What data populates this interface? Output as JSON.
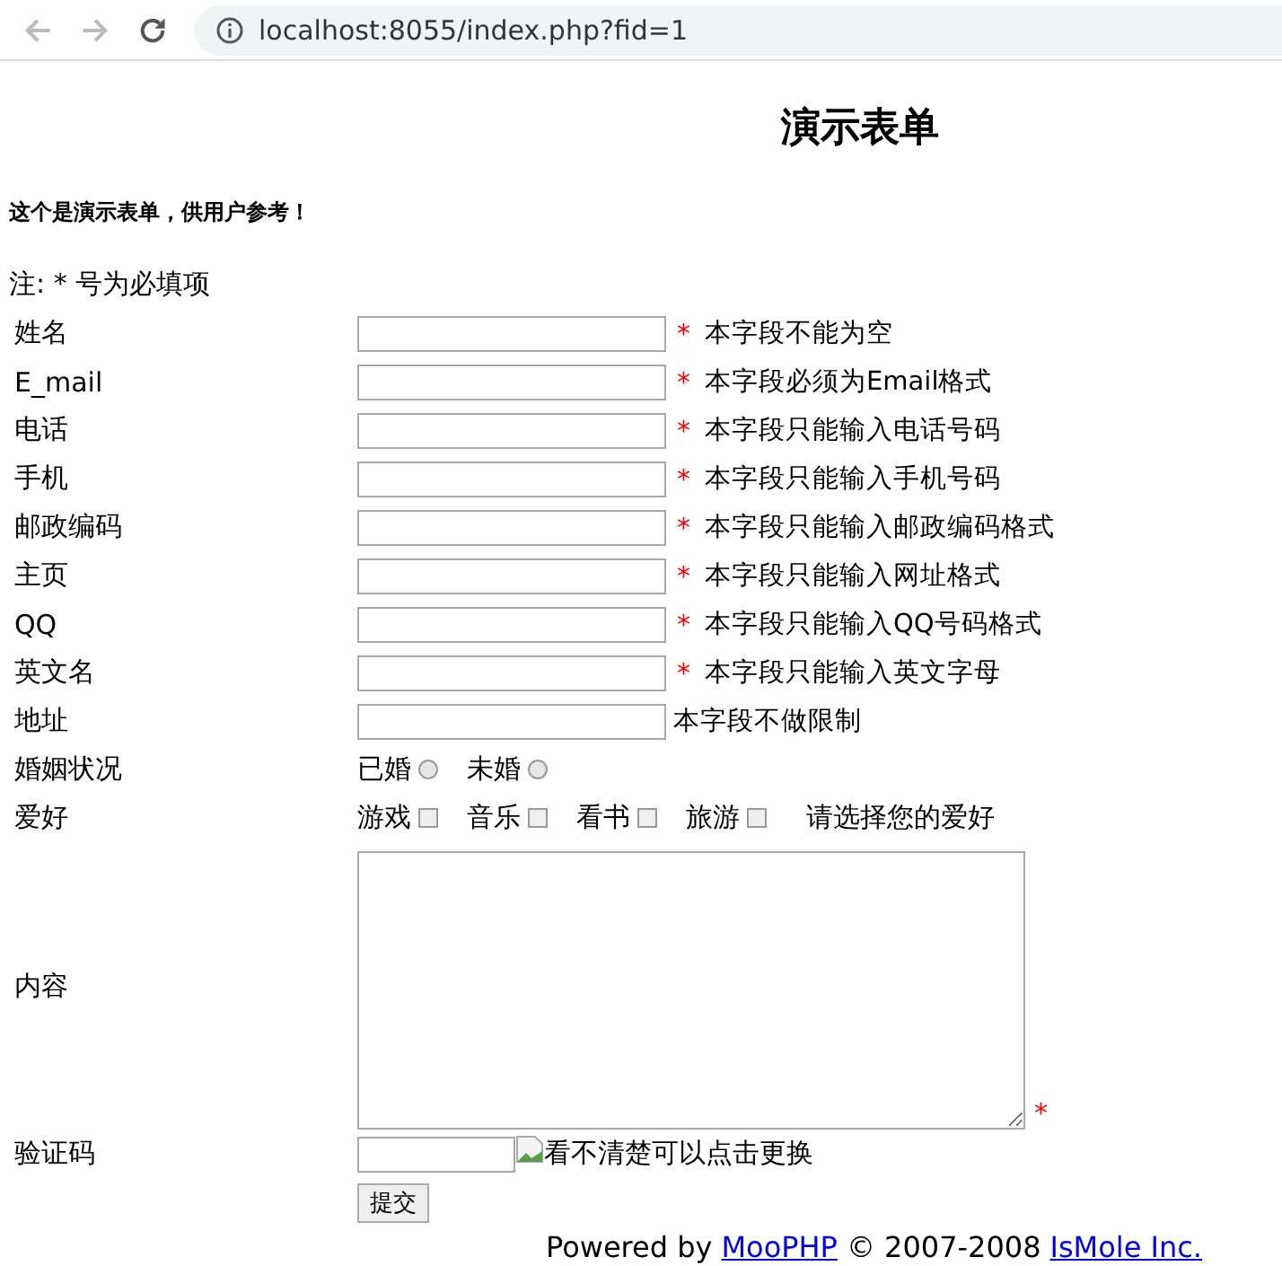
{
  "browser": {
    "url": "localhost:8055/index.php?fid=1"
  },
  "title": "演示表单",
  "intro": "这个是演示表单，供用户参考！",
  "note": "注: * 号为必填项",
  "required_mark": "*",
  "fields": [
    {
      "kind": "text",
      "label": "姓名",
      "required": true,
      "hint": "本字段不能为空"
    },
    {
      "kind": "text",
      "label": "E_mail",
      "required": true,
      "hint": "本字段必须为Email格式"
    },
    {
      "kind": "text",
      "label": "电话",
      "required": true,
      "hint": "本字段只能输入电话号码"
    },
    {
      "kind": "text",
      "label": "手机",
      "required": true,
      "hint": "本字段只能输入手机号码"
    },
    {
      "kind": "text",
      "label": "邮政编码",
      "required": true,
      "hint": "本字段只能输入邮政编码格式"
    },
    {
      "kind": "text",
      "label": "主页",
      "required": true,
      "hint": "本字段只能输入网址格式"
    },
    {
      "kind": "text",
      "label": "QQ",
      "required": true,
      "hint": "本字段只能输入QQ号码格式"
    },
    {
      "kind": "text",
      "label": "英文名",
      "required": true,
      "hint": "本字段只能输入英文字母"
    },
    {
      "kind": "text",
      "label": "地址",
      "required": false,
      "hint": "本字段不做限制"
    },
    {
      "kind": "radio",
      "label": "婚姻状况",
      "options": [
        {
          "label": "已婚",
          "selected": false
        },
        {
          "label": "未婚",
          "selected": false
        }
      ]
    },
    {
      "kind": "checkbox",
      "label": "爱好",
      "options": [
        {
          "label": "游戏",
          "checked": false
        },
        {
          "label": "音乐",
          "checked": false
        },
        {
          "label": "看书",
          "checked": false
        },
        {
          "label": "旅游",
          "checked": false
        }
      ],
      "hint": "请选择您的爱好"
    },
    {
      "kind": "textarea",
      "label": "内容",
      "required": true
    },
    {
      "kind": "captcha",
      "label": "验证码",
      "image_alt": "看不清楚可以点击更换"
    }
  ],
  "submit": "提交",
  "footer": {
    "prefix": "Powered by",
    "link1": "MooPHP",
    "middle": "© 2007-2008",
    "link2": "IsMole Inc."
  }
}
